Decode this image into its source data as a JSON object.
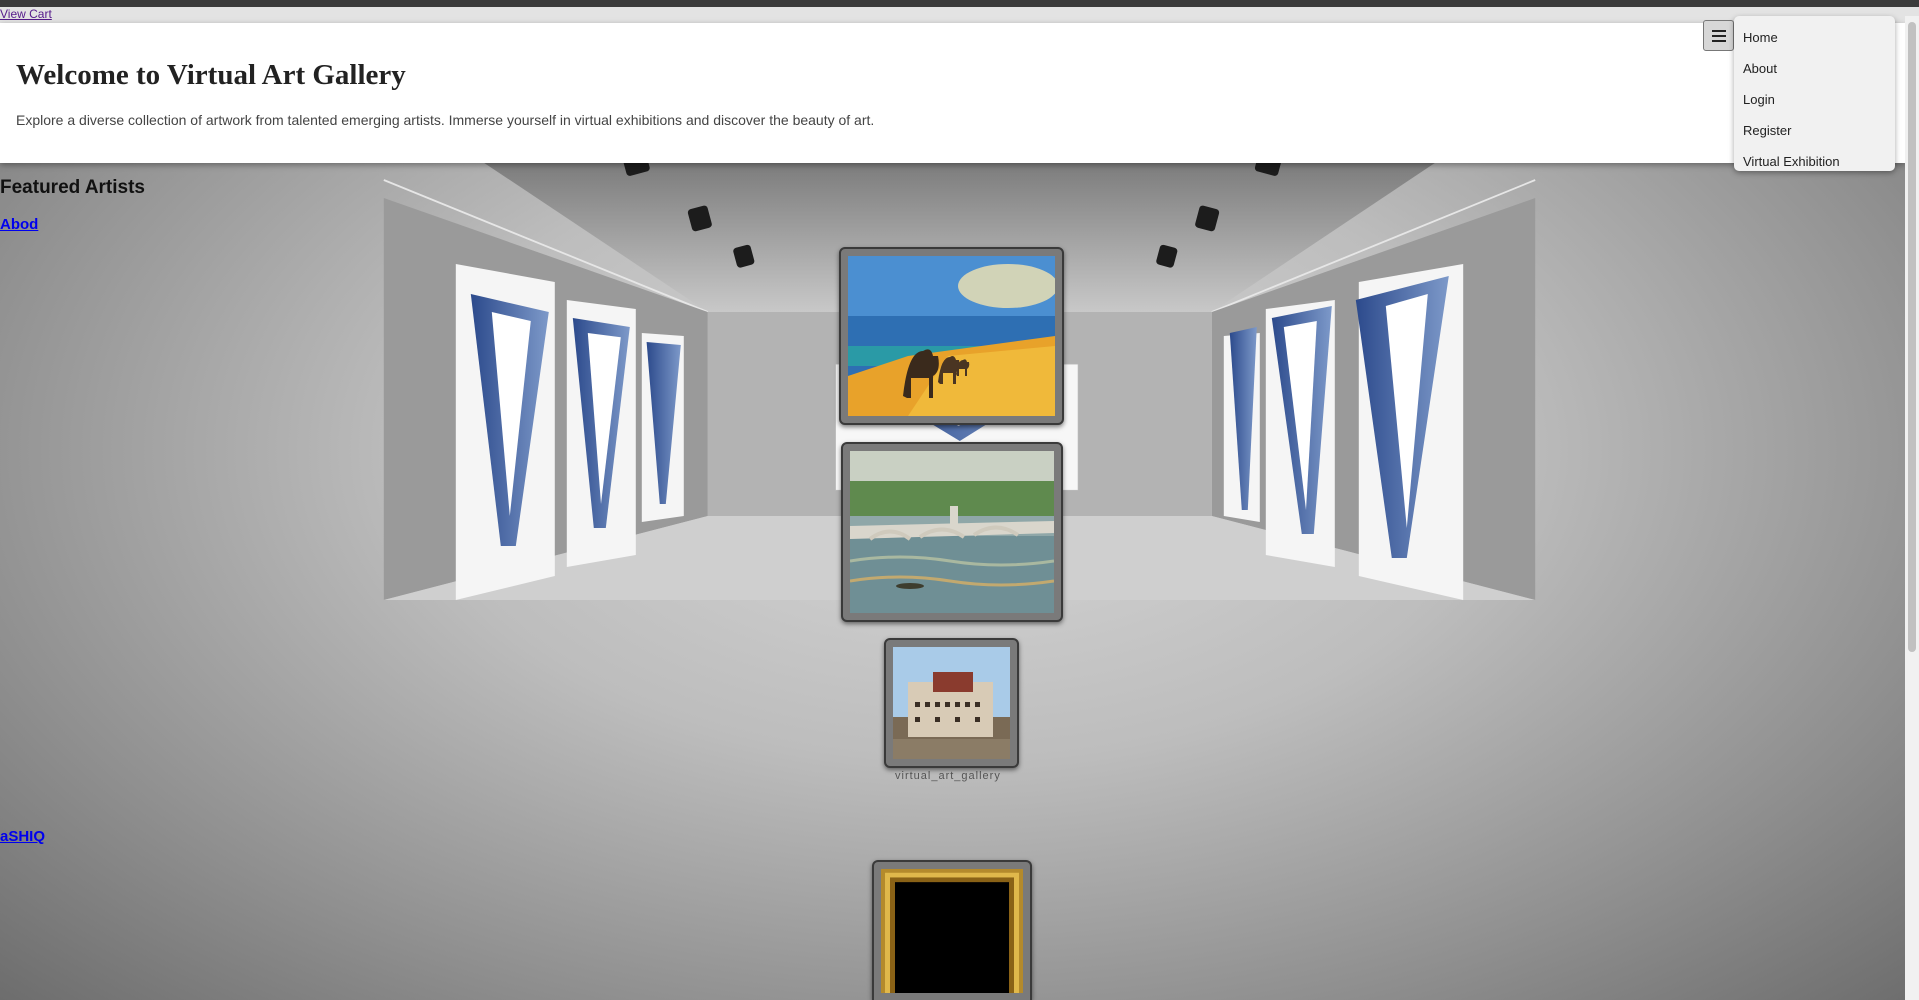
{
  "header": {
    "view_cart": "View Cart",
    "title": "Welcome to Virtual Art Gallery",
    "description": "Explore a diverse collection of artwork from talented emerging artists. Immerse yourself in virtual exhibitions and discover the beauty of art."
  },
  "nav": {
    "toggle_icon": "hamburger-icon",
    "items": [
      {
        "label": "Home"
      },
      {
        "label": "About"
      },
      {
        "label": "Login"
      },
      {
        "label": "Register"
      },
      {
        "label": "Virtual Exhibition"
      }
    ]
  },
  "featured": {
    "title": "Featured Artists",
    "artists": [
      {
        "name": "Abod"
      },
      {
        "name": "aSHIQ"
      }
    ]
  },
  "background": {
    "logo_caption": "virtual_art_gallery"
  },
  "colors": {
    "link": "#0000ee",
    "visited_link": "#551a8b",
    "frame": "#7a7a7a",
    "logo_blue": "#2c4a8c"
  }
}
